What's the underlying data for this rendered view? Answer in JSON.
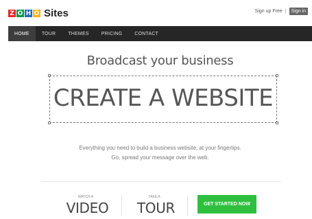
{
  "brand": {
    "logo_letters": [
      "Z",
      "O",
      "H",
      "O"
    ],
    "logo_colors": [
      "#e42527",
      "#089949",
      "#226db4",
      "#f9b21d"
    ],
    "name": "Sites"
  },
  "top_links": {
    "signup": "Sign up Free",
    "separator": "|",
    "signin": "Sign in"
  },
  "nav": {
    "items": [
      {
        "label": "HOME",
        "active": true
      },
      {
        "label": "TOUR",
        "active": false
      },
      {
        "label": "THEMES",
        "active": false
      },
      {
        "label": "PRICING",
        "active": false
      },
      {
        "label": "CONTACT",
        "active": false
      }
    ]
  },
  "hero": {
    "tagline": "Broadcast your business",
    "headline": "CREATE A WEBSITE",
    "description_line1": "Everything you need to build a business website, at your fingertips.",
    "description_line2": "Go, spread your message over the web."
  },
  "cta": {
    "video_small": "WATCH A",
    "video_big": "VIDEO",
    "tour_small": "TAKE A",
    "tour_big": "TOUR",
    "get_started": "GET STARTED NOW",
    "accent_color": "#2fbf3f"
  }
}
